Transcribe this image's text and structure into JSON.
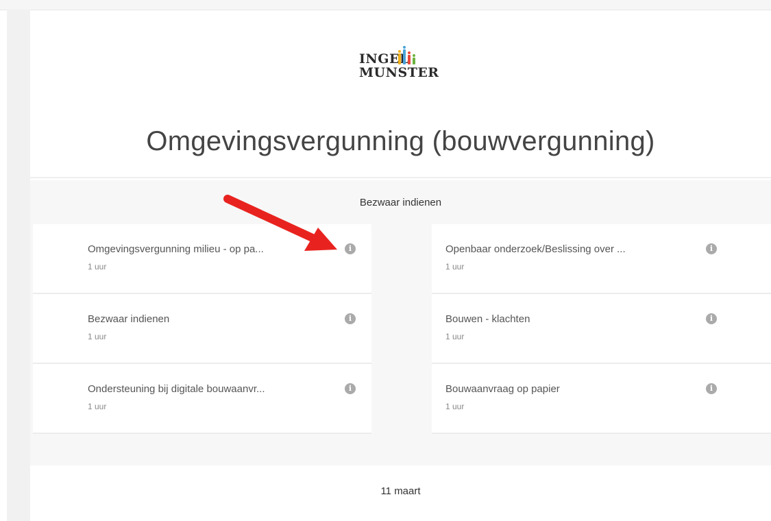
{
  "logo": {
    "line1": "INGEL",
    "line2": "MUNSTER",
    "bar_colors": [
      "#f2b21b",
      "#4aa3d8",
      "#e8483b",
      "#6cb33f"
    ]
  },
  "page_title": "Omgevingsvergunning (bouwvergunning)",
  "section": {
    "heading": "Bezwaar indienen",
    "left_items": [
      {
        "name": "Omgevingsvergunning milieu - op pa...",
        "duration": "1 uur"
      },
      {
        "name": "Bezwaar indienen",
        "duration": "1 uur"
      },
      {
        "name": "Ondersteuning bij digitale bouwaanvr...",
        "duration": "1 uur"
      }
    ],
    "right_items": [
      {
        "name": "Openbaar onderzoek/Beslissing over ...",
        "duration": "1 uur"
      },
      {
        "name": "Bouwen - klachten",
        "duration": "1 uur"
      },
      {
        "name": "Bouwaanvraag op papier",
        "duration": "1 uur"
      }
    ],
    "info_glyph": "i"
  },
  "date_label": "11 maart",
  "colors": {
    "arrow": "#e8231f",
    "info_icon": "#aaaaaa",
    "section_bg": "#f7f7f7"
  }
}
